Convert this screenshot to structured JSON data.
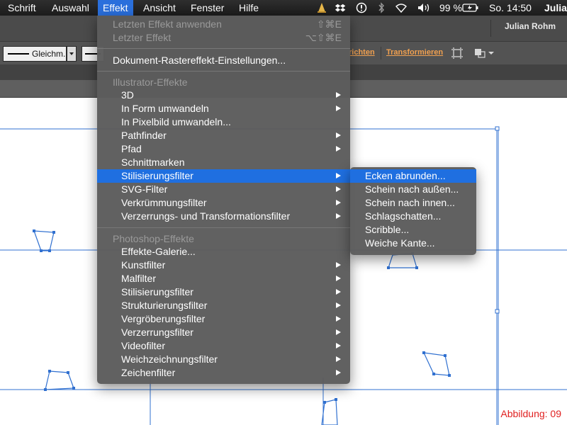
{
  "menubar": {
    "items": [
      {
        "label": "Schrift"
      },
      {
        "label": "Auswahl"
      },
      {
        "label": "Effekt"
      },
      {
        "label": "Ansicht"
      },
      {
        "label": "Fenster"
      },
      {
        "label": "Hilfe"
      }
    ],
    "battery_percent": "99 %",
    "clock": "So. 14:50",
    "user_truncated": "Julia",
    "tray_icons": [
      "cone-icon",
      "dropbox-icon",
      "sync-icon",
      "bluetooth-icon",
      "wifi-icon",
      "volume-icon",
      "battery-icon"
    ]
  },
  "toolbar": {
    "user": "Julian Rohm",
    "stroke_label": "Gleichm.",
    "links": [
      "richten",
      "Transformieren"
    ]
  },
  "effekt_menu": {
    "items": [
      {
        "label": "Letzten Effekt anwenden",
        "shortcut": "⇧⌘E",
        "disabled": true
      },
      {
        "label": "Letzter Effekt",
        "shortcut": "⌥⇧⌘E",
        "disabled": true
      },
      {
        "label": "Dokument-Rastereffekt-Einstellungen..."
      },
      {
        "label": "Illustrator-Effekte"
      },
      {
        "label": "3D"
      },
      {
        "label": "In Form umwandeln"
      },
      {
        "label": "In Pixelbild umwandeln..."
      },
      {
        "label": "Pathfinder"
      },
      {
        "label": "Pfad"
      },
      {
        "label": "Schnittmarken"
      },
      {
        "label": "Stilisierungsfilter",
        "highlighted": true
      },
      {
        "label": "SVG-Filter"
      },
      {
        "label": "Verkrümmungsfilter"
      },
      {
        "label": "Verzerrungs- und Transformationsfilter"
      },
      {
        "label": "Photoshop-Effekte"
      },
      {
        "label": "Effekte-Galerie..."
      },
      {
        "label": "Kunstfilter"
      },
      {
        "label": "Malfilter"
      },
      {
        "label": "Stilisierungsfilter"
      },
      {
        "label": "Strukturierungsfilter"
      },
      {
        "label": "Vergröberungsfilter"
      },
      {
        "label": "Verzerrungsfilter"
      },
      {
        "label": "Videofilter"
      },
      {
        "label": "Weichzeichnungsfilter"
      },
      {
        "label": "Zeichenfilter"
      }
    ]
  },
  "submenu": {
    "items": [
      {
        "label": "Ecken abrunden...",
        "highlighted": true
      },
      {
        "label": "Schein nach außen..."
      },
      {
        "label": "Schein nach innen..."
      },
      {
        "label": "Schlagschatten..."
      },
      {
        "label": "Scribble..."
      },
      {
        "label": "Weiche Kante..."
      }
    ]
  },
  "figure_label": "Abbildung: 09",
  "colors": {
    "menubar_bg": "#1f1f1f",
    "menu_bg": "#5c5c5c",
    "highlight": "#1f6fe0",
    "accent_link": "#f0a050",
    "guide_line": "#3070d0",
    "figure_label": "#e02020"
  }
}
